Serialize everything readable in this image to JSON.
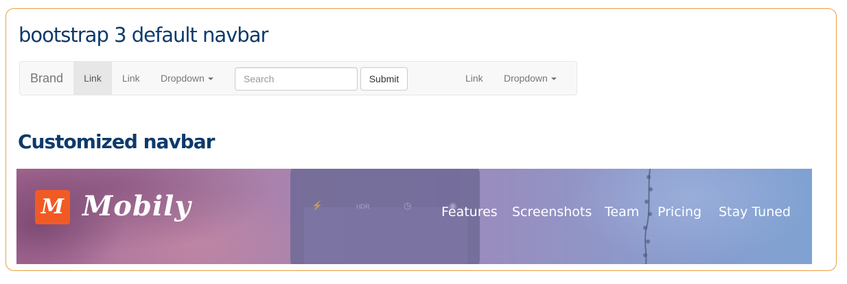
{
  "headings": {
    "default_title": "bootstrap 3 default navbar",
    "custom_title": "Customized navbar"
  },
  "bootstrap_navbar": {
    "brand": "Brand",
    "left_links": [
      "Link",
      "Link"
    ],
    "left_dropdown": "Dropdown",
    "search_placeholder": "Search",
    "search_value": "",
    "submit_label": "Submit",
    "right_link": "Link",
    "right_dropdown": "Dropdown",
    "active_item": "Link"
  },
  "custom_navbar": {
    "logo_letter": "M",
    "logo_text": "Mobily",
    "links": [
      "Features",
      "Screenshots",
      "Team",
      "Pricing",
      "Stay Tuned"
    ],
    "logo_color": "#f25a24"
  },
  "colors": {
    "frame_border": "#e8a040",
    "heading_color": "#0e3a6a"
  }
}
